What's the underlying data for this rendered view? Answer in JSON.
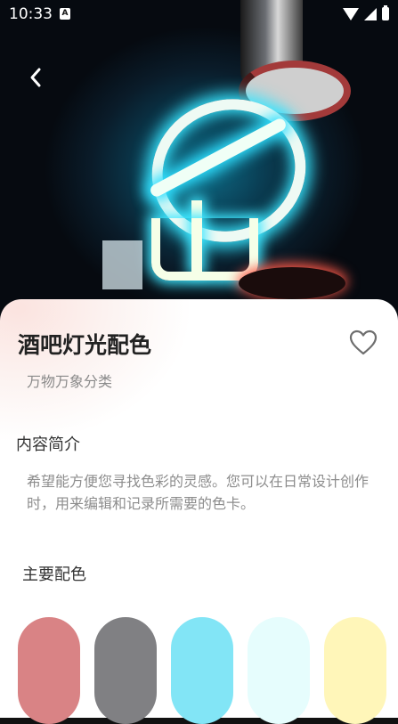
{
  "status_bar": {
    "time": "10:33",
    "badge": "A"
  },
  "page": {
    "title": "酒吧灯光配色",
    "subtitle": "万物万象分类",
    "intro_heading": "内容简介",
    "description": "希望能方便您寻找色彩的灵感。您可以在日常设计创作时，用来编辑和记录所需要的色卡。",
    "palette_heading": "主要配色"
  },
  "palette": [
    "#d98385",
    "#808083",
    "#82e5f6",
    "#e6fdfd",
    "#fff6b9"
  ]
}
